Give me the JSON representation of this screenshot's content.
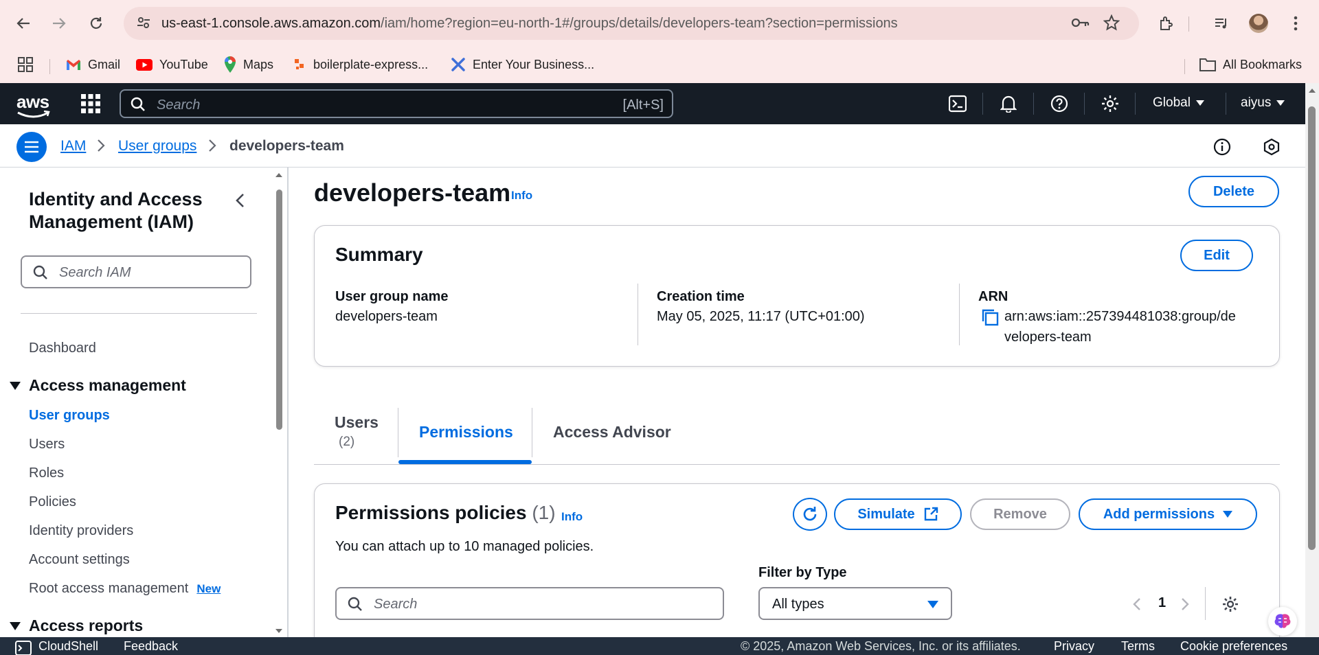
{
  "browser": {
    "url_host": "us-east-1.console.aws.amazon.com",
    "url_path": "/iam/home?region=eu-north-1#/groups/details/developers-team?section=permissions",
    "bookmarks": [
      "Gmail",
      "YouTube",
      "Maps",
      "boilerplate-express...",
      "Enter Your Business..."
    ],
    "all_bookmarks": "All Bookmarks"
  },
  "aws": {
    "logo": "aws",
    "search_placeholder": "Search",
    "search_shortcut": "[Alt+S]",
    "region": "Global",
    "user": "aiyus"
  },
  "breadcrumb": {
    "items": [
      "IAM",
      "User groups",
      "developers-team"
    ]
  },
  "sidebar": {
    "title": "Identity and Access Management (IAM)",
    "search_placeholder": "Search IAM",
    "dashboard": "Dashboard",
    "section_access_mgmt": "Access management",
    "items": [
      "User groups",
      "Users",
      "Roles",
      "Policies",
      "Identity providers",
      "Account settings",
      "Root access management"
    ],
    "new_badge": "New",
    "section_access_reports": "Access reports"
  },
  "page": {
    "title": "developers-team",
    "info": "Info",
    "delete": "Delete"
  },
  "summary": {
    "heading": "Summary",
    "edit": "Edit",
    "group_name_label": "User group name",
    "group_name": "developers-team",
    "creation_label": "Creation time",
    "creation": "May 05, 2025, 11:17 (UTC+01:00)",
    "arn_label": "ARN",
    "arn_line1": "arn:aws:iam::257394481038:group/de",
    "arn_line2": "velopers-team"
  },
  "tabs": {
    "users": "Users",
    "users_count": "(2)",
    "permissions": "Permissions",
    "access_advisor": "Access Advisor"
  },
  "policies": {
    "heading": "Permissions policies",
    "count": "(1)",
    "info": "Info",
    "simulate": "Simulate",
    "remove": "Remove",
    "add_permissions": "Add permissions",
    "description": "You can attach up to 10 managed policies.",
    "filter_label": "Filter by Type",
    "filter_value": "All types",
    "search_placeholder": "Search",
    "page": "1"
  },
  "footer": {
    "cloudshell": "CloudShell",
    "feedback": "Feedback",
    "copyright": "© 2025, Amazon Web Services, Inc. or its affiliates.",
    "privacy": "Privacy",
    "terms": "Terms",
    "cookies": "Cookie preferences"
  },
  "colors": {
    "accent": "#006ce0",
    "aws_bar": "#161d26",
    "chrome_bg": "#fbeaea"
  }
}
